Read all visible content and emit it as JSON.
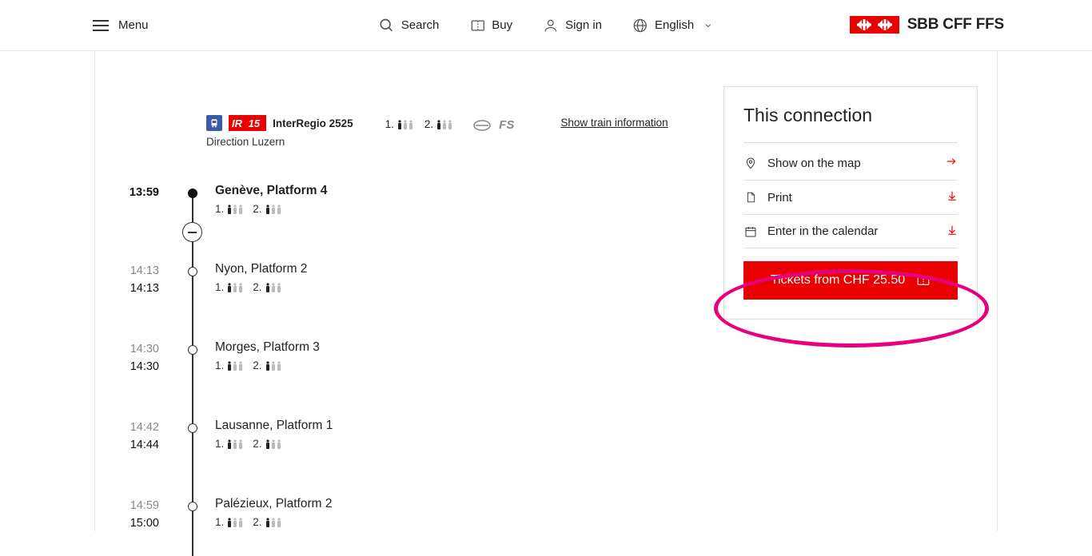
{
  "header": {
    "menu": "Menu",
    "search": "Search",
    "buy": "Buy",
    "signin": "Sign in",
    "language": "English",
    "brand": "SBB CFF FFS"
  },
  "train": {
    "badge_line": "IR",
    "badge_num": "15",
    "name": "InterRegio 2525",
    "direction": "Direction Luzern",
    "class1_label": "1.",
    "class2_label": "2.",
    "fs_label": "FS",
    "show_info": "Show train information"
  },
  "stops": [
    {
      "arr": "",
      "dep": "13:59",
      "name": "Genève, Platform 4",
      "bold": true
    },
    {
      "arr": "14:13",
      "dep": "14:13",
      "name": "Nyon, Platform 2",
      "bold": false
    },
    {
      "arr": "14:30",
      "dep": "14:30",
      "name": "Morges, Platform 3",
      "bold": false
    },
    {
      "arr": "14:42",
      "dep": "14:44",
      "name": "Lausanne, Platform 1",
      "bold": false
    },
    {
      "arr": "14:59",
      "dep": "15:00",
      "name": "Palézieux, Platform 2",
      "bold": false
    }
  ],
  "occ": {
    "c1": "1.",
    "c2": "2."
  },
  "panel": {
    "title": "This connection",
    "map": "Show on the map",
    "print": "Print",
    "calendar": "Enter in the calendar",
    "tickets": "Tickets from CHF 25.50"
  }
}
